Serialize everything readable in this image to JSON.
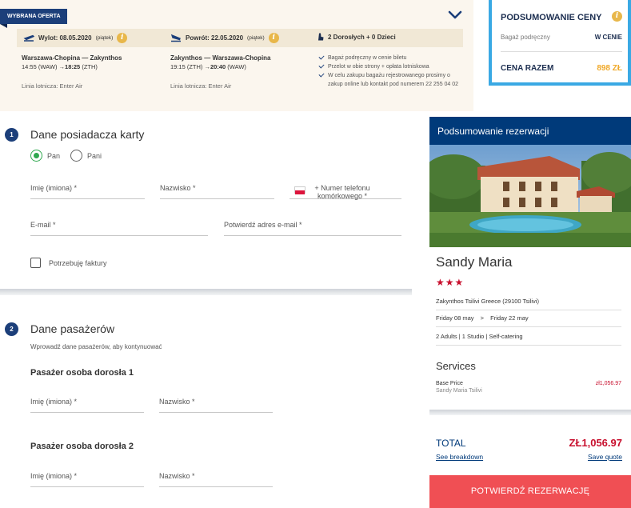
{
  "offer": {
    "badge": "WYBRANA OFERTA",
    "departure": {
      "label": "Wylot: 08.05.2020",
      "day": "(piątek)"
    },
    "return": {
      "label": "Powrót: 22.05.2020",
      "day": "(piątek)"
    },
    "travellers": "2 Dorosłych + 0 Dzieci",
    "outbound": {
      "route": "Warszawa-Chopina — Zakynthos",
      "time_prefix": "14:55 (WAW) →",
      "time_bold": "18:25",
      "time_suffix": "(ZTH)",
      "carrier": "Linia lotnicza: Enter Air"
    },
    "inbound": {
      "route": "Zakynthos — Warszawa-Chopina",
      "time_prefix": "19:15 (ZTH) →",
      "time_bold": "20:40",
      "time_suffix": "(WAW)",
      "carrier": "Linia lotnicza: Enter Air"
    },
    "checks": [
      "Bagaż podręczny w cenie biletu",
      "Przelot w obie strony + opłata lotniskowa",
      "W celu zakupu bagażu rejestrowanego prosimy o zakup online lub kontakt pod numerem 22 255 04 02"
    ]
  },
  "price_summary": {
    "title": "PODSUMOWANIE CENY",
    "baggage_label": "Bagaż podręczny",
    "baggage_value": "W CENIE",
    "total_label": "CENA RAZEM",
    "total_value": "898 ZŁ"
  },
  "cardholder": {
    "step": "1",
    "title": "Dane posiadacza karty",
    "radio_mr": "Pan",
    "radio_mrs": "Pani",
    "first_name": "Imię (imiona) *",
    "last_name": "Nazwisko *",
    "phone_line1": "+ Numer telefonu",
    "phone_line2": "komórkowego *",
    "email": "E-mail *",
    "email_confirm": "Potwierdź adres e-mail *",
    "invoice": "Potrzebuję faktury"
  },
  "passengers": {
    "step": "2",
    "title": "Dane pasażerów",
    "hint": "Wprowadź dane pasażerów, aby kontynuować",
    "p1_title": "Pasażer osoba dorosła 1",
    "p2_title": "Pasażer osoba dorosła 2",
    "first_name": "Imię (imiona) *",
    "last_name": "Nazwisko *"
  },
  "reservation": {
    "header": "Podsumowanie rezerwacji",
    "hotel": "Sandy Maria",
    "stars": "★★★",
    "address": "Zakynthos Tsilivi Greece (29100 Tsilivi)",
    "date_from": "Friday 08 may",
    "date_sep": ">",
    "date_to": "Friday 22 may",
    "room": "2 Adults | 1 Studio | Self-catering",
    "services_title": "Services",
    "base_price_label": "Base Price",
    "base_price_sub": "Sandy Maria Tsilivi",
    "base_price_value": "zł1,056.97",
    "total_label": "TOTAL",
    "total_value": "ZŁ1,056.97",
    "breakdown_link": "See breakdown",
    "save_link": "Save quote",
    "confirm_button": "POTWIERDŹ REZERWACJĘ"
  },
  "colors": {
    "navy": "#1c3f7a",
    "reservation_header": "#003a7a",
    "accent_red": "#c8102e",
    "confirm_button": "#f04f54",
    "price_box_border": "#3aa9e4",
    "total_orange": "#f0a92a",
    "radio_green": "#2fa84f"
  }
}
